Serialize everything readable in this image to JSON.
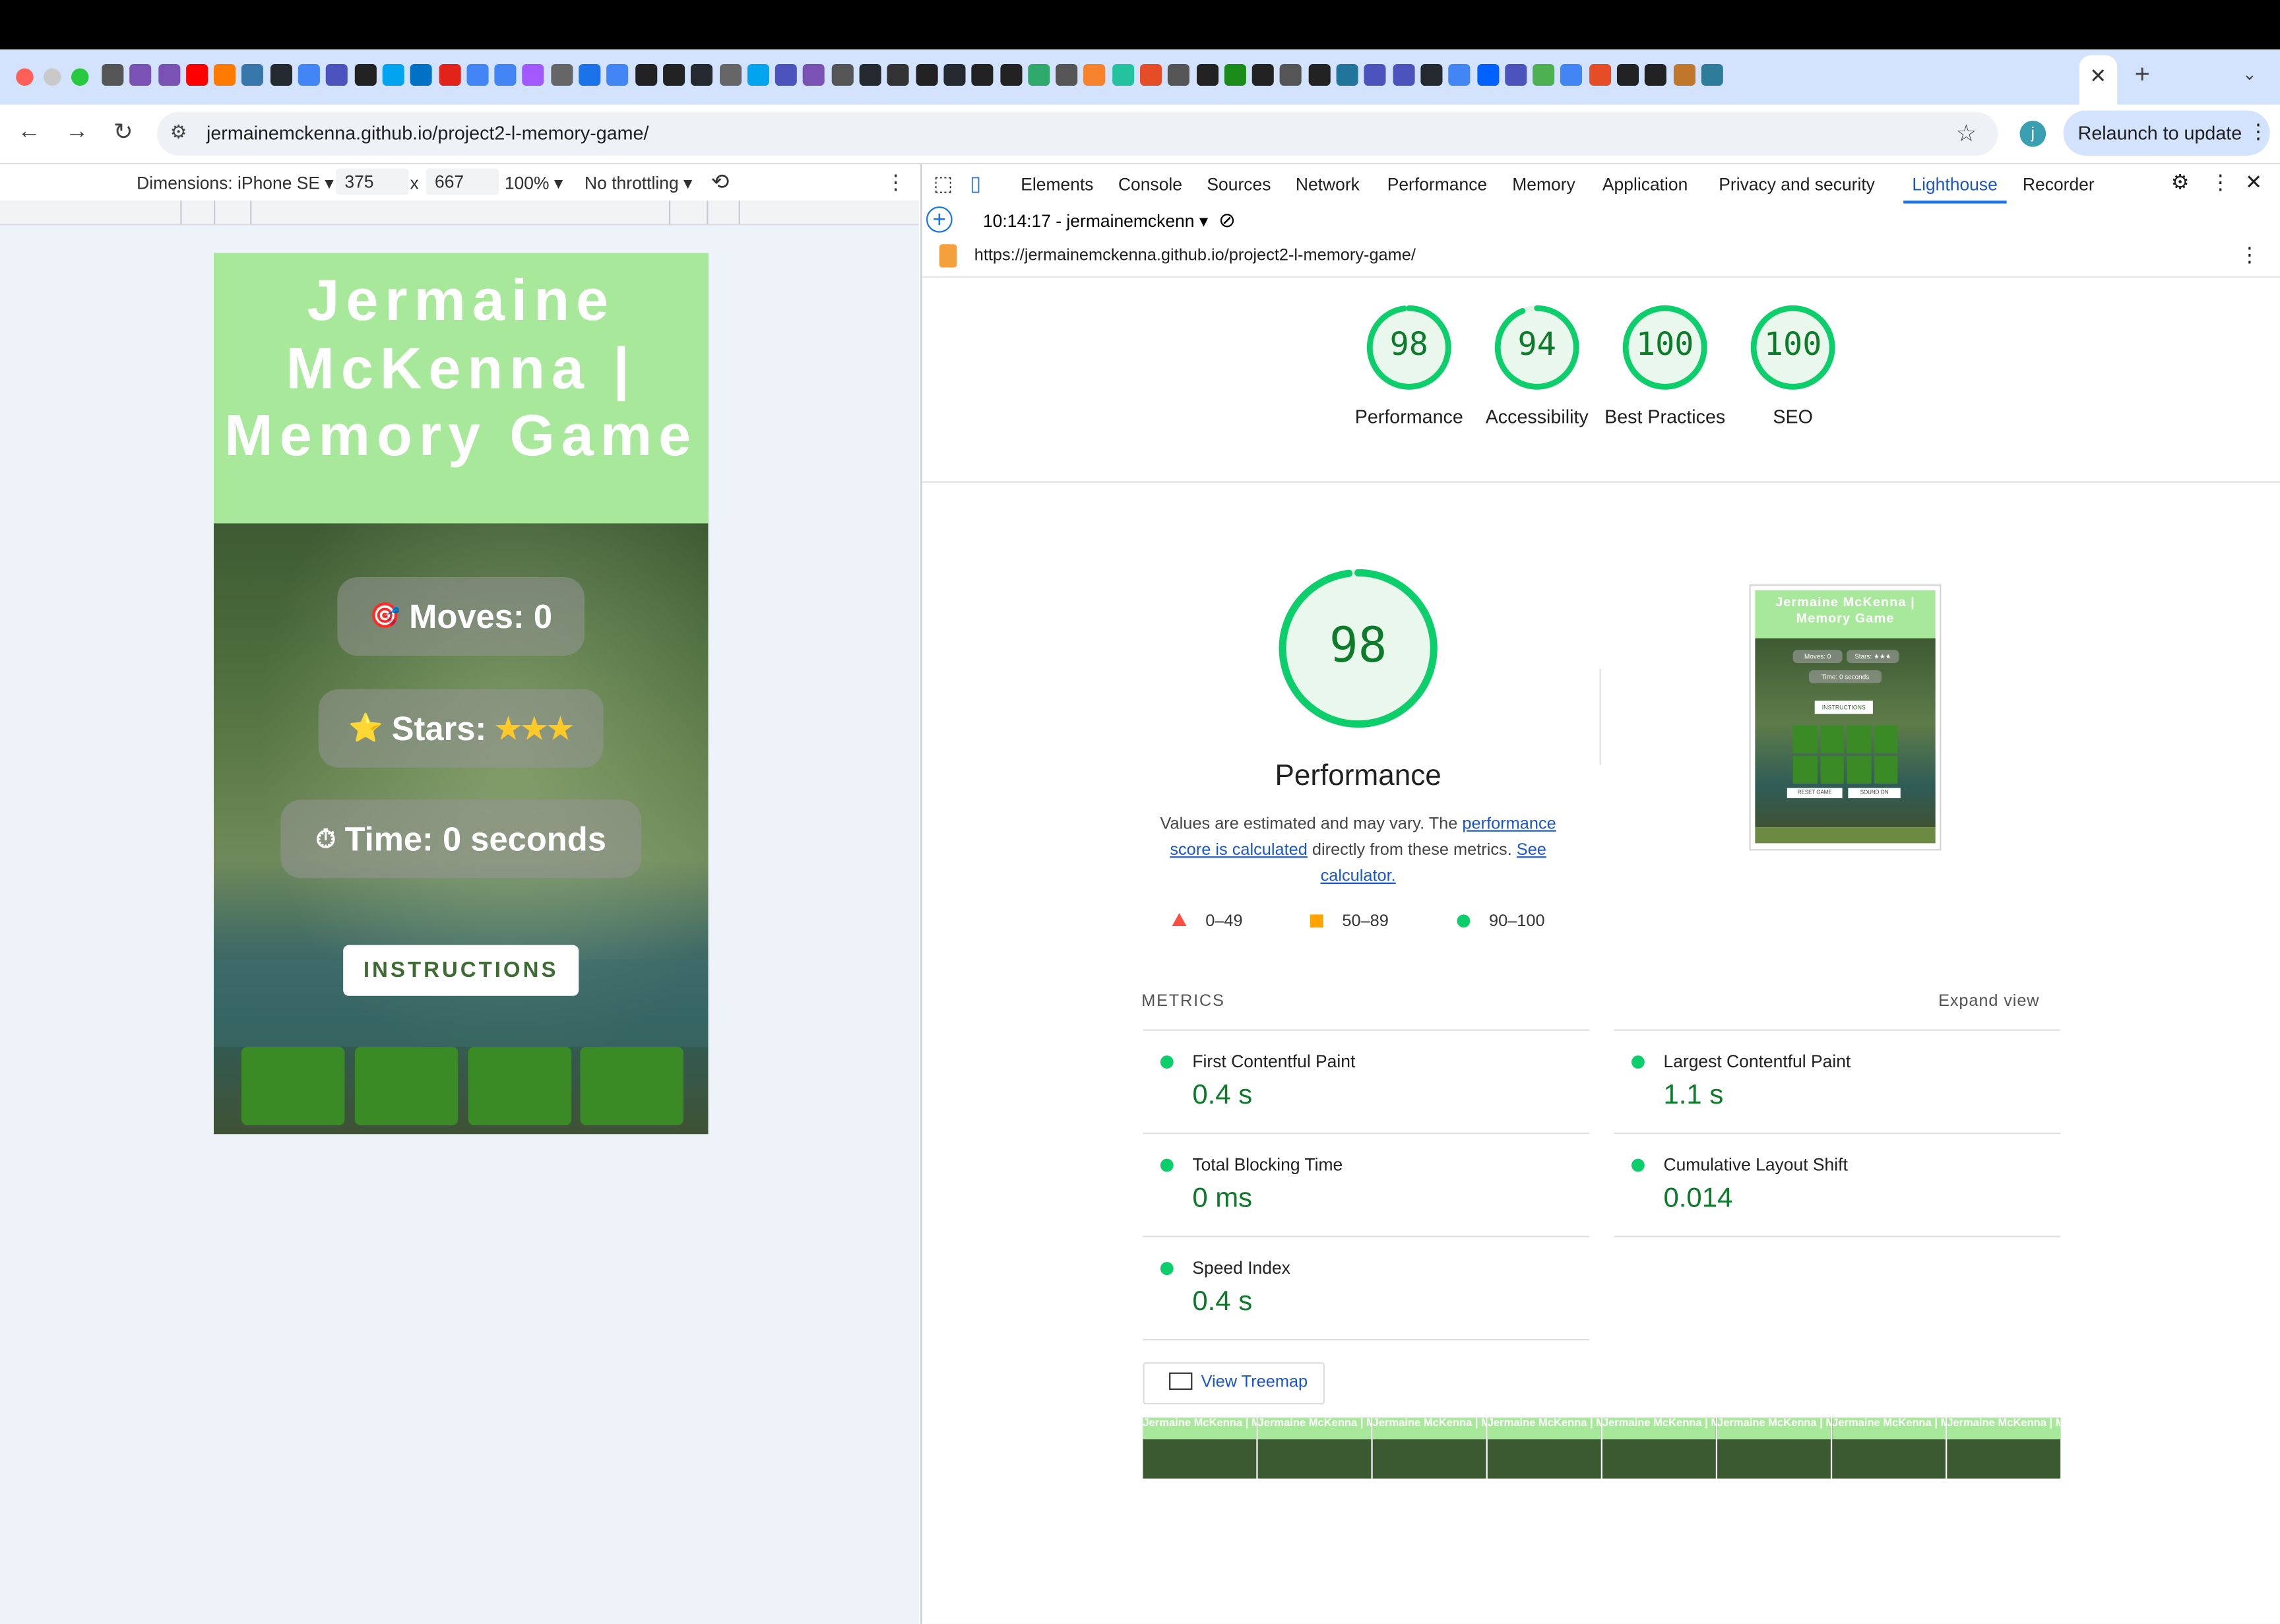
{
  "browser": {
    "url": "jermainemckenna.github.io/project2-l-memory-game/",
    "relaunch_label": "Relaunch to update",
    "profile_initial": "j",
    "new_tab": "+"
  },
  "device_toolbar": {
    "dimensions_label": "Dimensions: iPhone SE",
    "width": "375",
    "x": "x",
    "height": "667",
    "zoom": "100%",
    "throttling": "No throttling"
  },
  "game": {
    "title": "Jermaine McKenna | Memory Game",
    "moves_label": "Moves: 0",
    "stars_label": "Stars:",
    "stars_value": "★★★",
    "time_label": "Time: 0 seconds",
    "instructions_label": "INSTRUCTIONS",
    "moves_icon": "🎯",
    "stars_icon": "⭐",
    "time_icon": "⏱"
  },
  "devtools": {
    "tabs": [
      "Elements",
      "Console",
      "Sources",
      "Network",
      "Performance",
      "Memory",
      "Application",
      "Privacy and security",
      "Lighthouse",
      "Recorder"
    ],
    "active_tab": "Lighthouse",
    "report_selector": "10:14:17 - jermainemckenn",
    "report_url": "https://jermainemckenna.github.io/project2-l-memory-game/"
  },
  "lighthouse": {
    "scores": [
      {
        "value": "98",
        "label": "Performance",
        "fraction": 0.98
      },
      {
        "value": "94",
        "label": "Accessibility",
        "fraction": 0.94
      },
      {
        "value": "100",
        "label": "Best Practices",
        "fraction": 1.0
      },
      {
        "value": "100",
        "label": "SEO",
        "fraction": 1.0
      }
    ],
    "main_score": "98",
    "main_fraction": 0.98,
    "main_label": "Performance",
    "desc_prefix": "Values are estimated and may vary. The ",
    "desc_link1": "performance score is calculated",
    "desc_mid": " directly from these metrics. ",
    "desc_link2": "See calculator.",
    "legend": [
      "0–49",
      "50–89",
      "90–100"
    ],
    "metrics_title": "METRICS",
    "expand_view": "Expand view",
    "metrics": [
      {
        "label": "First Contentful Paint",
        "value": "0.4 s"
      },
      {
        "label": "Largest Contentful Paint",
        "value": "1.1 s"
      },
      {
        "label": "Total Blocking Time",
        "value": "0 ms"
      },
      {
        "label": "Cumulative Layout Shift",
        "value": "0.014"
      },
      {
        "label": "Speed Index",
        "value": "0.4 s"
      }
    ],
    "treemap_label": "View Treemap",
    "thumb_title": "Jermaine McKenna | Memory Game",
    "thumb_instructions": "INSTRUCTIONS",
    "thumb_reset": "RESET GAME",
    "thumb_sound": "SOUND ON",
    "thumb_moves": "Moves: 0",
    "thumb_stars": "Stars: ★★★",
    "thumb_time": "Time: 0 seconds",
    "film_title": "Jermaine McKenna | Memory Game"
  },
  "colors": {
    "pass": "#0cce6b",
    "pass_text": "#0c7b2a",
    "average": "#ffa400",
    "fail": "#ff4e42",
    "header_green": "#a8e89a",
    "card_green": "#3a8a26"
  }
}
